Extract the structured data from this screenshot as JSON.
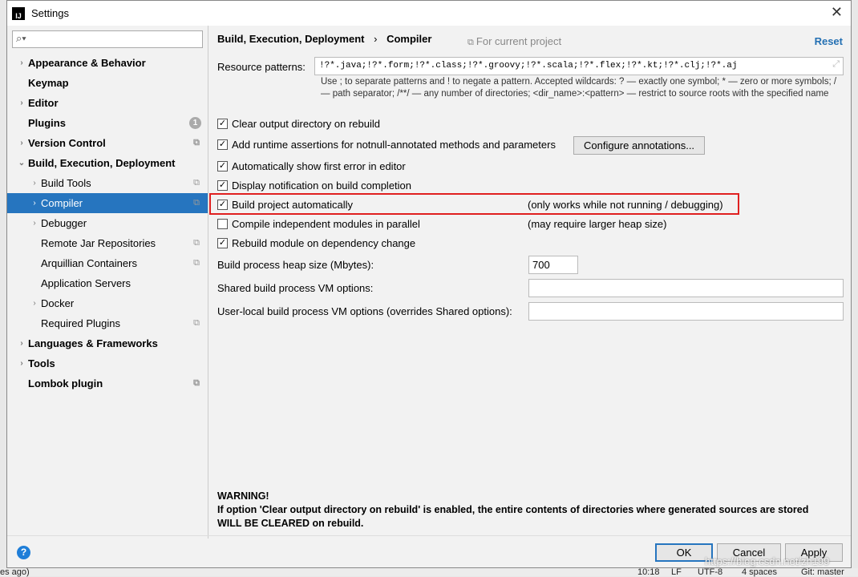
{
  "window": {
    "title": "Settings",
    "logo": "IJ"
  },
  "search": {
    "placeholder": "",
    "icon": "search-icon"
  },
  "sidebar": {
    "items": [
      {
        "label": "Appearance & Behavior",
        "bold": true,
        "arrow": true
      },
      {
        "label": "Keymap",
        "bold": true
      },
      {
        "label": "Editor",
        "bold": true,
        "arrow": true
      },
      {
        "label": "Plugins",
        "bold": true,
        "badge": "1"
      },
      {
        "label": "Version Control",
        "bold": true,
        "arrow": true,
        "copy": true
      },
      {
        "label": "Build, Execution, Deployment",
        "bold": true,
        "arrow": true,
        "expanded": true
      },
      {
        "label": "Build Tools",
        "arrow": true,
        "copy": true,
        "indent": 1
      },
      {
        "label": "Compiler",
        "arrow": true,
        "copy": true,
        "indent": 1,
        "selected": true
      },
      {
        "label": "Debugger",
        "arrow": true,
        "indent": 1
      },
      {
        "label": "Remote Jar Repositories",
        "copy": true,
        "indent": 1
      },
      {
        "label": "Arquillian Containers",
        "copy": true,
        "indent": 1
      },
      {
        "label": "Application Servers",
        "indent": 1
      },
      {
        "label": "Docker",
        "arrow": true,
        "indent": 1
      },
      {
        "label": "Required Plugins",
        "copy": true,
        "indent": 1
      },
      {
        "label": "Languages & Frameworks",
        "bold": true,
        "arrow": true
      },
      {
        "label": "Tools",
        "bold": true,
        "arrow": true
      },
      {
        "label": "Lombok plugin",
        "bold": true,
        "copy": true
      }
    ]
  },
  "main": {
    "breadcrumb": {
      "parent": "Build, Execution, Deployment",
      "sep": "›",
      "current": "Compiler"
    },
    "for_current_project": "For current project",
    "reset": "Reset",
    "resource_patterns": {
      "label": "Resource patterns:",
      "value": "!?*.java;!?*.form;!?*.class;!?*.groovy;!?*.scala;!?*.flex;!?*.kt;!?*.clj;!?*.aj"
    },
    "help": "Use ; to separate patterns and ! to negate a pattern. Accepted wildcards: ? — exactly one symbol; * — zero or more symbols; / — path separator; /**/ — any number of directories; <dir_name>:<pattern> — restrict to source roots with the specified name",
    "checkboxes": [
      {
        "label": "Clear output directory on rebuild",
        "checked": true
      },
      {
        "label": "Add runtime assertions for notnull-annotated methods and parameters",
        "checked": true
      },
      {
        "label": "Automatically show first error in editor",
        "checked": true
      },
      {
        "label": "Display notification on build completion",
        "checked": true
      },
      {
        "label": "Build project automatically",
        "checked": true,
        "note": "(only works while not running / debugging)"
      },
      {
        "label": "Compile independent modules in parallel",
        "checked": false,
        "note": "(may require larger heap size)"
      },
      {
        "label": "Rebuild module on dependency change",
        "checked": true
      }
    ],
    "configure_annotations": "Configure annotations...",
    "heap": {
      "label": "Build process heap size (Mbytes):",
      "value": "700"
    },
    "shared_vm": {
      "label": "Shared build process VM options:",
      "value": ""
    },
    "user_vm": {
      "label": "User-local build process VM options (overrides Shared options):",
      "value": ""
    },
    "warning": {
      "title": "WARNING!",
      "line1": "If option 'Clear output directory on rebuild' is enabled, the entire contents of directories where generated sources are stored",
      "line2": "WILL BE CLEARED on rebuild."
    }
  },
  "buttons": {
    "ok": "OK",
    "cancel": "Cancel",
    "apply": "Apply",
    "help": "?"
  },
  "watermark": "https://blog.csdn.net/zh199",
  "statusbar": {
    "left": "es ago)",
    "items": [
      "10:18",
      "LF",
      "UTF-8",
      "4 spaces",
      "Git: master"
    ]
  }
}
